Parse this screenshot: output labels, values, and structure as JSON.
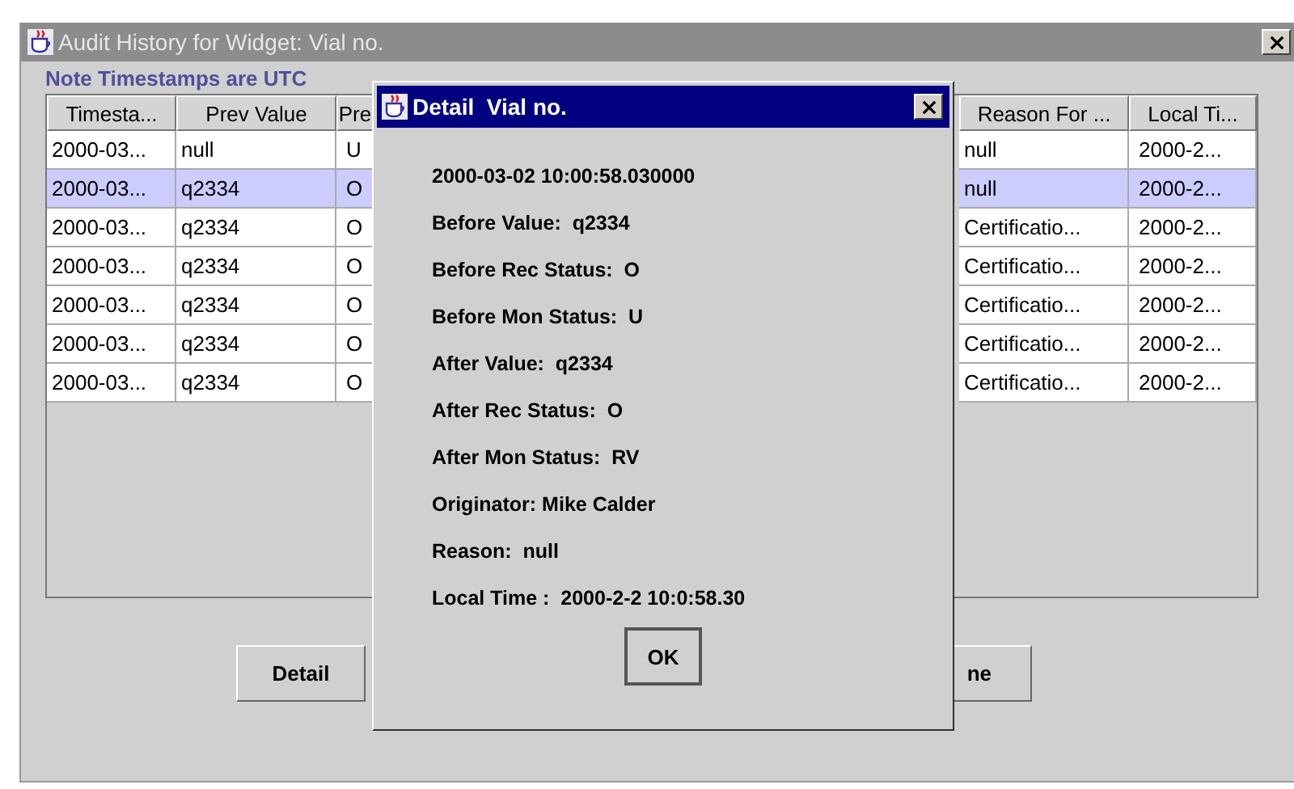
{
  "main_window": {
    "title": "Audit History for Widget: Vial no.",
    "note": "Note Timestamps are UTC",
    "table": {
      "columns": [
        "Timesta...",
        "Prev Value",
        "Pre",
        "Reason For ...",
        "Local Ti..."
      ],
      "rows": [
        {
          "cells": [
            "2000-03...",
            "null",
            "U",
            "null",
            "2000-2..."
          ],
          "selected": false
        },
        {
          "cells": [
            "2000-03...",
            "q2334",
            "O",
            "null",
            "2000-2..."
          ],
          "selected": true
        },
        {
          "cells": [
            "2000-03...",
            "q2334",
            "O",
            "Certificatio...",
            "2000-2..."
          ],
          "selected": false
        },
        {
          "cells": [
            "2000-03...",
            "q2334",
            "O",
            "Certificatio...",
            "2000-2..."
          ],
          "selected": false
        },
        {
          "cells": [
            "2000-03...",
            "q2334",
            "O",
            "Certificatio...",
            "2000-2..."
          ],
          "selected": false
        },
        {
          "cells": [
            "2000-03...",
            "q2334",
            "O",
            "Certificatio...",
            "2000-2..."
          ],
          "selected": false
        },
        {
          "cells": [
            "2000-03...",
            "q2334",
            "O",
            "Certificatio...",
            "2000-2..."
          ],
          "selected": false
        }
      ]
    },
    "buttons": [
      "Detail",
      "ne"
    ]
  },
  "dialog": {
    "title": "Detail  Vial no.",
    "lines": [
      "2000-03-02 10:00:58.030000",
      "Before Value:  q2334",
      "Before Rec Status:  O",
      "Before Mon Status:  U",
      "After Value:  q2334",
      "After Rec Status:  O",
      "After Mon Status:  RV",
      "Originator: Mike Calder",
      "Reason:  null",
      "Local Time :  2000-2-2 10:0:58.30"
    ],
    "ok": "OK"
  }
}
